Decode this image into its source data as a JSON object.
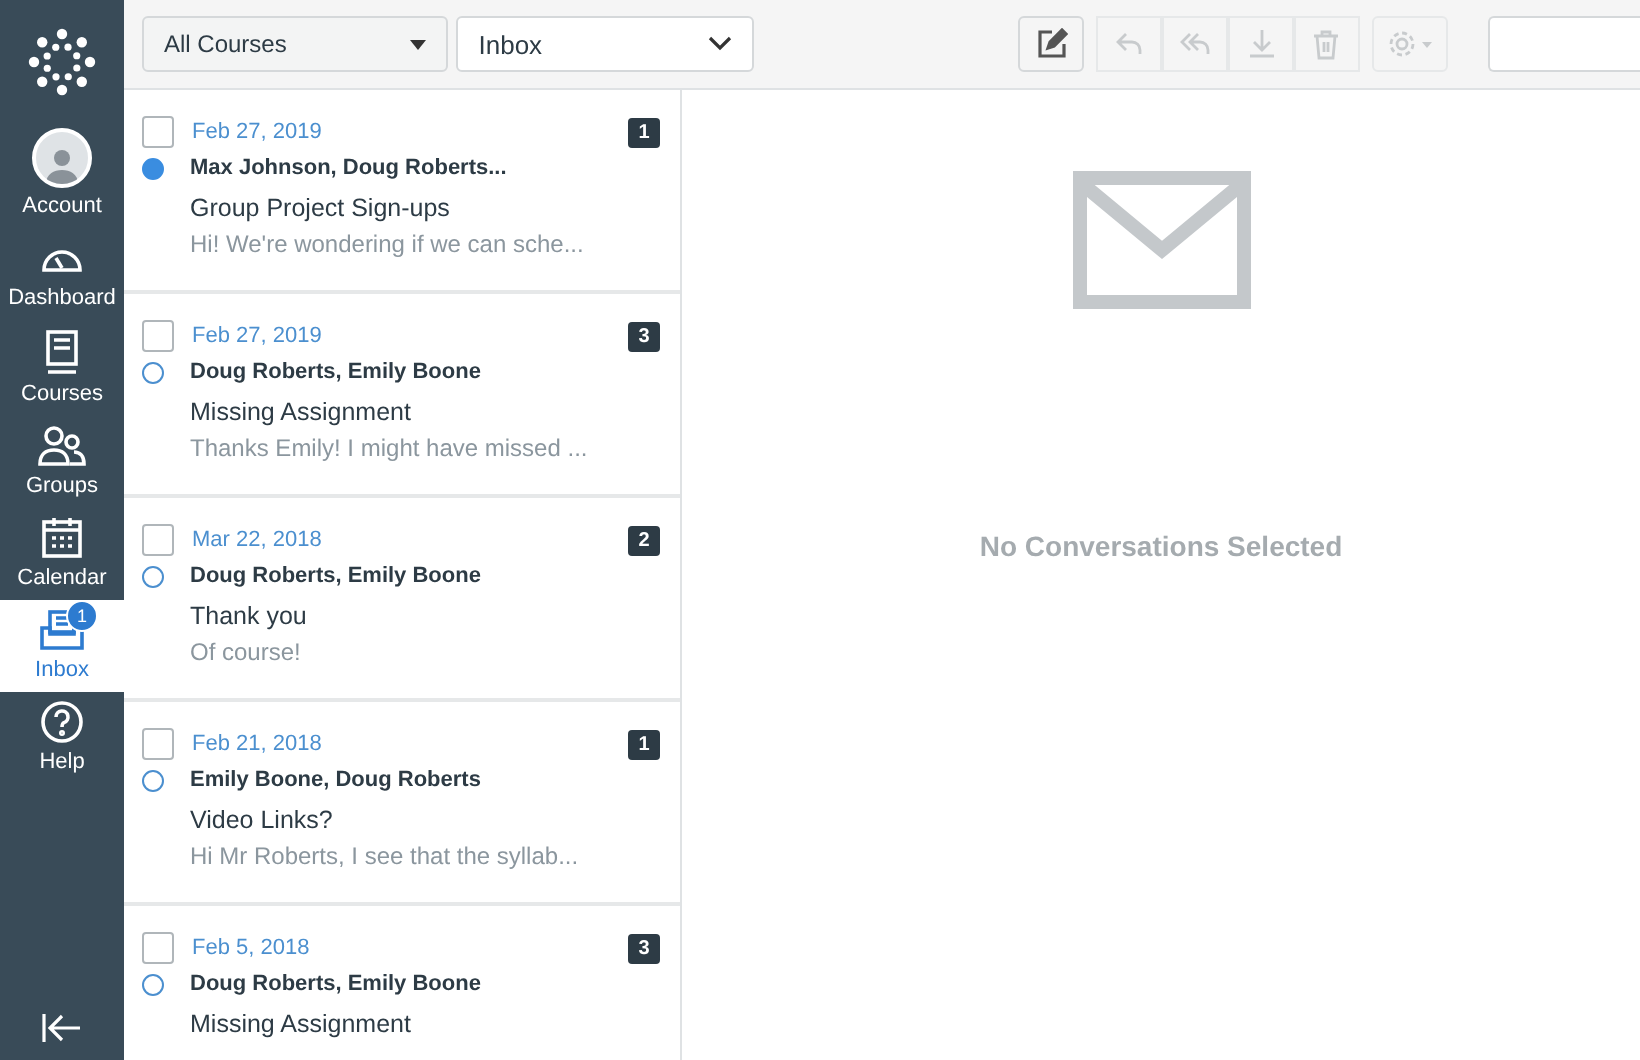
{
  "sidebar": {
    "items": [
      {
        "kind": "account",
        "label": "Account",
        "selected": false
      },
      {
        "kind": "dashboard",
        "label": "Dashboard",
        "selected": false
      },
      {
        "kind": "courses",
        "label": "Courses",
        "selected": false
      },
      {
        "kind": "groups",
        "label": "Groups",
        "selected": false
      },
      {
        "kind": "calendar",
        "label": "Calendar",
        "selected": false
      },
      {
        "kind": "inbox",
        "label": "Inbox",
        "selected": true,
        "badge": "1"
      },
      {
        "kind": "help",
        "label": "Help",
        "selected": false
      }
    ]
  },
  "toolbar": {
    "course_filter": "All Courses",
    "mailbox": "Inbox",
    "buttons": [
      {
        "kind": "compose",
        "disabled": false
      },
      {
        "kind": "reply",
        "disabled": true
      },
      {
        "kind": "reply-all",
        "disabled": true
      },
      {
        "kind": "archive",
        "disabled": true
      },
      {
        "kind": "delete",
        "disabled": true
      },
      {
        "kind": "settings",
        "disabled": true
      }
    ]
  },
  "conversations": [
    {
      "date": "Feb 27, 2019",
      "participants": "Max Johnson, Doug Roberts...",
      "subject": "Group Project Sign-ups",
      "preview": "Hi! We're wondering if we can sche...",
      "count": "1",
      "unread": true,
      "checked": false
    },
    {
      "date": "Feb 27, 2019",
      "participants": "Doug Roberts, Emily Boone",
      "subject": "Missing Assignment",
      "preview": "Thanks Emily! I might have missed ...",
      "count": "3",
      "unread": false,
      "checked": false
    },
    {
      "date": "Mar 22, 2018",
      "participants": "Doug Roberts, Emily Boone",
      "subject": "Thank you",
      "preview": "Of course!",
      "count": "2",
      "unread": false,
      "checked": false
    },
    {
      "date": "Feb 21, 2018",
      "participants": "Emily Boone, Doug Roberts",
      "subject": "Video Links?",
      "preview": "Hi Mr Roberts, I see that the syllab...",
      "count": "1",
      "unread": false,
      "checked": false
    },
    {
      "date": "Feb 5, 2018",
      "participants": "Doug Roberts, Emily Boone",
      "subject": "Missing Assignment",
      "count": "3",
      "unread": false,
      "checked": false
    }
  ],
  "detail": {
    "empty_message": "No Conversations Selected"
  }
}
